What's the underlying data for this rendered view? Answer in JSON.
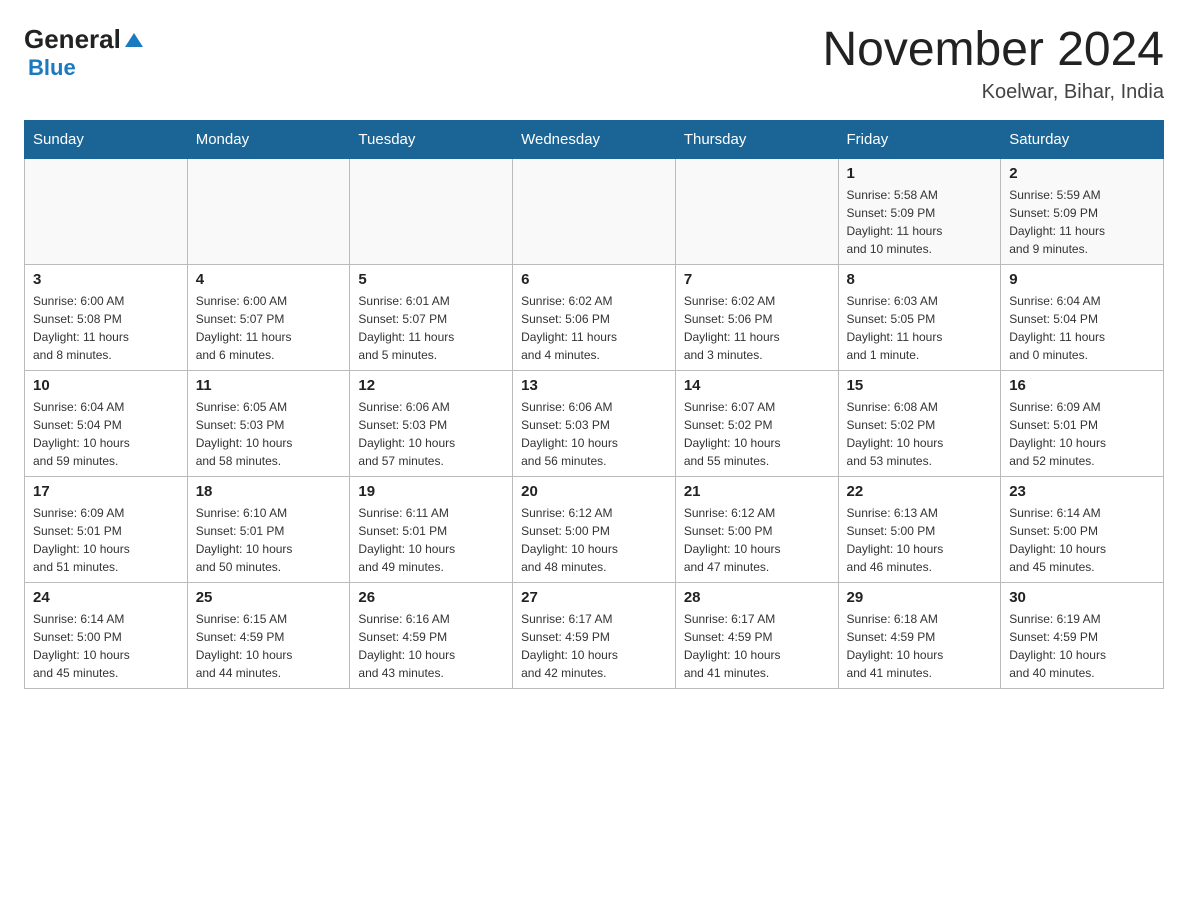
{
  "header": {
    "logo_line1": "General",
    "logo_line2": "Blue",
    "month_title": "November 2024",
    "location": "Koelwar, Bihar, India"
  },
  "weekdays": [
    "Sunday",
    "Monday",
    "Tuesday",
    "Wednesday",
    "Thursday",
    "Friday",
    "Saturday"
  ],
  "weeks": [
    [
      {
        "day": "",
        "info": ""
      },
      {
        "day": "",
        "info": ""
      },
      {
        "day": "",
        "info": ""
      },
      {
        "day": "",
        "info": ""
      },
      {
        "day": "",
        "info": ""
      },
      {
        "day": "1",
        "info": "Sunrise: 5:58 AM\nSunset: 5:09 PM\nDaylight: 11 hours\nand 10 minutes."
      },
      {
        "day": "2",
        "info": "Sunrise: 5:59 AM\nSunset: 5:09 PM\nDaylight: 11 hours\nand 9 minutes."
      }
    ],
    [
      {
        "day": "3",
        "info": "Sunrise: 6:00 AM\nSunset: 5:08 PM\nDaylight: 11 hours\nand 8 minutes."
      },
      {
        "day": "4",
        "info": "Sunrise: 6:00 AM\nSunset: 5:07 PM\nDaylight: 11 hours\nand 6 minutes."
      },
      {
        "day": "5",
        "info": "Sunrise: 6:01 AM\nSunset: 5:07 PM\nDaylight: 11 hours\nand 5 minutes."
      },
      {
        "day": "6",
        "info": "Sunrise: 6:02 AM\nSunset: 5:06 PM\nDaylight: 11 hours\nand 4 minutes."
      },
      {
        "day": "7",
        "info": "Sunrise: 6:02 AM\nSunset: 5:06 PM\nDaylight: 11 hours\nand 3 minutes."
      },
      {
        "day": "8",
        "info": "Sunrise: 6:03 AM\nSunset: 5:05 PM\nDaylight: 11 hours\nand 1 minute."
      },
      {
        "day": "9",
        "info": "Sunrise: 6:04 AM\nSunset: 5:04 PM\nDaylight: 11 hours\nand 0 minutes."
      }
    ],
    [
      {
        "day": "10",
        "info": "Sunrise: 6:04 AM\nSunset: 5:04 PM\nDaylight: 10 hours\nand 59 minutes."
      },
      {
        "day": "11",
        "info": "Sunrise: 6:05 AM\nSunset: 5:03 PM\nDaylight: 10 hours\nand 58 minutes."
      },
      {
        "day": "12",
        "info": "Sunrise: 6:06 AM\nSunset: 5:03 PM\nDaylight: 10 hours\nand 57 minutes."
      },
      {
        "day": "13",
        "info": "Sunrise: 6:06 AM\nSunset: 5:03 PM\nDaylight: 10 hours\nand 56 minutes."
      },
      {
        "day": "14",
        "info": "Sunrise: 6:07 AM\nSunset: 5:02 PM\nDaylight: 10 hours\nand 55 minutes."
      },
      {
        "day": "15",
        "info": "Sunrise: 6:08 AM\nSunset: 5:02 PM\nDaylight: 10 hours\nand 53 minutes."
      },
      {
        "day": "16",
        "info": "Sunrise: 6:09 AM\nSunset: 5:01 PM\nDaylight: 10 hours\nand 52 minutes."
      }
    ],
    [
      {
        "day": "17",
        "info": "Sunrise: 6:09 AM\nSunset: 5:01 PM\nDaylight: 10 hours\nand 51 minutes."
      },
      {
        "day": "18",
        "info": "Sunrise: 6:10 AM\nSunset: 5:01 PM\nDaylight: 10 hours\nand 50 minutes."
      },
      {
        "day": "19",
        "info": "Sunrise: 6:11 AM\nSunset: 5:01 PM\nDaylight: 10 hours\nand 49 minutes."
      },
      {
        "day": "20",
        "info": "Sunrise: 6:12 AM\nSunset: 5:00 PM\nDaylight: 10 hours\nand 48 minutes."
      },
      {
        "day": "21",
        "info": "Sunrise: 6:12 AM\nSunset: 5:00 PM\nDaylight: 10 hours\nand 47 minutes."
      },
      {
        "day": "22",
        "info": "Sunrise: 6:13 AM\nSunset: 5:00 PM\nDaylight: 10 hours\nand 46 minutes."
      },
      {
        "day": "23",
        "info": "Sunrise: 6:14 AM\nSunset: 5:00 PM\nDaylight: 10 hours\nand 45 minutes."
      }
    ],
    [
      {
        "day": "24",
        "info": "Sunrise: 6:14 AM\nSunset: 5:00 PM\nDaylight: 10 hours\nand 45 minutes."
      },
      {
        "day": "25",
        "info": "Sunrise: 6:15 AM\nSunset: 4:59 PM\nDaylight: 10 hours\nand 44 minutes."
      },
      {
        "day": "26",
        "info": "Sunrise: 6:16 AM\nSunset: 4:59 PM\nDaylight: 10 hours\nand 43 minutes."
      },
      {
        "day": "27",
        "info": "Sunrise: 6:17 AM\nSunset: 4:59 PM\nDaylight: 10 hours\nand 42 minutes."
      },
      {
        "day": "28",
        "info": "Sunrise: 6:17 AM\nSunset: 4:59 PM\nDaylight: 10 hours\nand 41 minutes."
      },
      {
        "day": "29",
        "info": "Sunrise: 6:18 AM\nSunset: 4:59 PM\nDaylight: 10 hours\nand 41 minutes."
      },
      {
        "day": "30",
        "info": "Sunrise: 6:19 AM\nSunset: 4:59 PM\nDaylight: 10 hours\nand 40 minutes."
      }
    ]
  ]
}
